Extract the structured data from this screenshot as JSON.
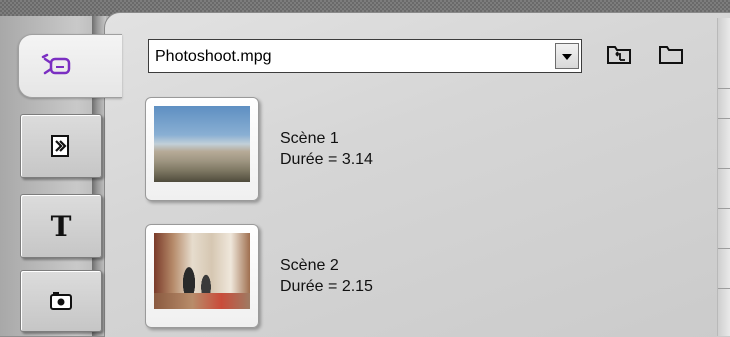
{
  "media_selector": {
    "value": "Photoshoot.mpg"
  },
  "tabs": [
    {
      "id": "video",
      "icon": "video-camera-icon",
      "active": true
    },
    {
      "id": "transitions",
      "icon": "transitions-icon",
      "active": false
    },
    {
      "id": "titles",
      "icon": "title-text-icon",
      "active": false,
      "glyph": "T"
    },
    {
      "id": "photos",
      "icon": "camera-icon",
      "active": false
    }
  ],
  "toolbar": {
    "up_folder_icon": "folder-up-icon",
    "folder_icon": "folder-icon"
  },
  "scenes": [
    {
      "name": "Scène 1",
      "duration": "Durée = 3.14"
    },
    {
      "name": "Scène 2",
      "duration": "Durée = 2.15"
    }
  ],
  "colors": {
    "accent": "#7b2fc2"
  }
}
